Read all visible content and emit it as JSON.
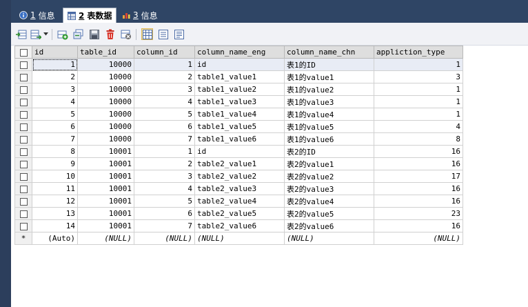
{
  "tabs": [
    {
      "num": "1",
      "label": "信息",
      "icon": "info-icon",
      "active": false
    },
    {
      "num": "2",
      "label": "表数据",
      "icon": "table-icon",
      "active": true
    },
    {
      "num": "3",
      "label": "信息",
      "icon": "info-chart-icon",
      "active": false
    }
  ],
  "toolbar": {
    "icons": [
      "import-icon",
      "export-icon",
      "insert-row-icon",
      "duplicate-row-icon",
      "save-icon",
      "delete-icon",
      "cancel-icon",
      "grid-view-icon",
      "form-view-icon",
      "text-view-icon"
    ]
  },
  "grid": {
    "columns": [
      "id",
      "table_id",
      "column_id",
      "column_name_eng",
      "column_name_chn",
      "appliction_type"
    ],
    "rows": [
      [
        "1",
        "10000",
        "1",
        "id",
        "表1的ID",
        "1"
      ],
      [
        "2",
        "10000",
        "2",
        "table1_value1",
        "表1的value1",
        "3"
      ],
      [
        "3",
        "10000",
        "3",
        "table1_value2",
        "表1的value2",
        "1"
      ],
      [
        "4",
        "10000",
        "4",
        "table1_value3",
        "表1的value3",
        "1"
      ],
      [
        "5",
        "10000",
        "5",
        "table1_value4",
        "表1的value4",
        "1"
      ],
      [
        "6",
        "10000",
        "6",
        "table1_value5",
        "表1的value5",
        "4"
      ],
      [
        "7",
        "10000",
        "7",
        "table1_value6",
        "表1的value6",
        "8"
      ],
      [
        "8",
        "10001",
        "1",
        "id",
        "表2的ID",
        "16"
      ],
      [
        "9",
        "10001",
        "2",
        "table2_value1",
        "表2的value1",
        "16"
      ],
      [
        "10",
        "10001",
        "3",
        "table2_value2",
        "表2的value2",
        "17"
      ],
      [
        "11",
        "10001",
        "4",
        "table2_value3",
        "表2的value3",
        "16"
      ],
      [
        "12",
        "10001",
        "5",
        "table2_value4",
        "表2的value4",
        "16"
      ],
      [
        "13",
        "10001",
        "6",
        "table2_value5",
        "表2的value5",
        "23"
      ],
      [
        "14",
        "10001",
        "7",
        "table2_value6",
        "表2的value6",
        "16"
      ]
    ],
    "new_row": {
      "marker": "*",
      "values": [
        "(Auto)",
        "(NULL)",
        "(NULL)",
        "(NULL)",
        "(NULL)",
        "(NULL)"
      ]
    }
  }
}
